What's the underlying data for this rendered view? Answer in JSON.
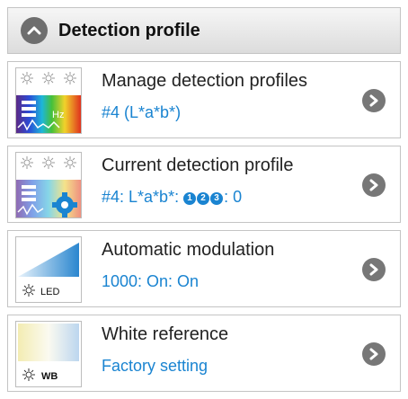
{
  "header": {
    "title": "Detection profile"
  },
  "rows": [
    {
      "label": "Manage detection profiles",
      "value": "#4 (L*a*b*)",
      "icon": "manage-profiles-icon",
      "thumb_text": "Hz"
    },
    {
      "label": "Current detection profile",
      "value_prefix": "#4: L*a*b*: ",
      "dots": [
        "1",
        "2",
        "3"
      ],
      "value_suffix": ": 0",
      "icon": "current-profile-icon"
    },
    {
      "label": "Automatic modulation",
      "value": "1000: On: On",
      "icon": "modulation-icon",
      "thumb_text": "LED"
    },
    {
      "label": "White reference",
      "value": "Factory setting",
      "icon": "white-reference-icon",
      "thumb_text": "WB"
    }
  ],
  "colors": {
    "accent": "#1a84d1",
    "chevron": "#777777",
    "header_gradient_top": "#f6f6f6",
    "header_gradient_bottom": "#dcdcdc"
  }
}
